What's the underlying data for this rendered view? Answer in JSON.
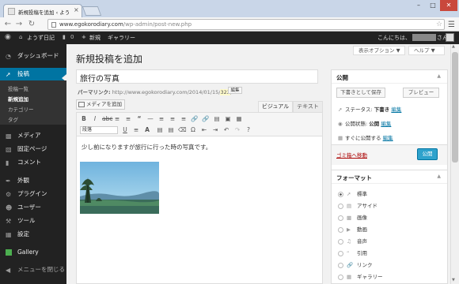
{
  "browser": {
    "tab_title": "新規投稿を追加 ‹ ようず日記",
    "tab_close": "×",
    "url_host": "www.egokorodiary.com",
    "url_path": "/wp-admin/post-new.php",
    "window_min": "–",
    "window_max": "□",
    "window_close": "✕"
  },
  "adminbar": {
    "site_name": "ようず日記",
    "comments_count": "0",
    "new_label": "新規",
    "gallery_label": "ギャラリー",
    "greeting": "こんにちは、",
    "greeting_suffix": "さん!"
  },
  "sidebar": {
    "items": [
      {
        "label": "ダッシュボード",
        "icon": "dashboard-icon"
      },
      {
        "label": "投稿",
        "icon": "pin-icon"
      },
      {
        "label": "メディア",
        "icon": "media-icon"
      },
      {
        "label": "固定ページ",
        "icon": "page-icon"
      },
      {
        "label": "コメント",
        "icon": "comment-icon"
      },
      {
        "label": "外観",
        "icon": "appearance-icon"
      },
      {
        "label": "プラグイン",
        "icon": "plugin-icon"
      },
      {
        "label": "ユーザー",
        "icon": "user-icon"
      },
      {
        "label": "ツール",
        "icon": "tool-icon"
      },
      {
        "label": "設定",
        "icon": "settings-icon"
      },
      {
        "label": "Gallery",
        "icon": "gallery-icon"
      },
      {
        "label": "メニューを閉じる",
        "icon": "collapse-icon"
      }
    ],
    "submenu": [
      "投稿一覧",
      "新規追加",
      "カテゴリー",
      "タグ"
    ]
  },
  "main": {
    "page_title": "新規投稿を追加",
    "screen_options": "表示オプション ▼",
    "help": "ヘルプ ▼",
    "post_title": "旅行の写真",
    "permalink_label": "パーマリンク:",
    "permalink_url": "http://www.egokorodiary.com/2014/01/15/",
    "permalink_slug": "322",
    "permalink_end": "/",
    "edit_button": "編集",
    "add_media": "メディアを追加",
    "tab_visual": "ビジュアル",
    "tab_text": "テキスト",
    "format_select": "段落",
    "body_text": "少し前になりますが旅行に行った時の写真です。"
  },
  "publish": {
    "title": "公開",
    "save_draft": "下書きとして保存",
    "preview": "プレビュー",
    "status_label": "ステータス:",
    "status_value": "下書き",
    "visibility_label": "公開状態:",
    "visibility_value": "公開",
    "schedule_label": "すぐに公開する",
    "edit_link": "編集",
    "trash": "ゴミ箱へ移動",
    "publish_button": "公開"
  },
  "format": {
    "title": "フォーマット",
    "options": [
      "標準",
      "アサイド",
      "画像",
      "動画",
      "音声",
      "引用",
      "リンク",
      "ギャラリー"
    ],
    "selected": "標準"
  },
  "colors": {
    "admin_bar": "#222222",
    "accent": "#0074a2",
    "publish_button": "#2ea2cc"
  }
}
